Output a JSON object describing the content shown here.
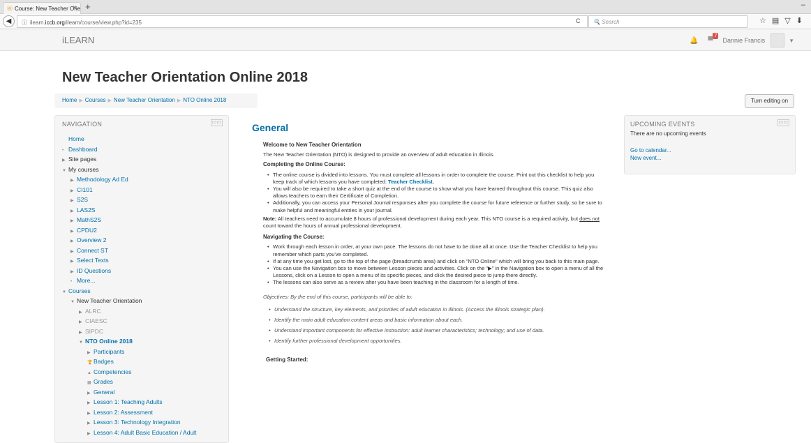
{
  "browser": {
    "tab_title": "Course: New Teacher Orient",
    "tab_close": "×",
    "new_tab": "+",
    "url_prefix": "ilearn.",
    "url_domain": "iccb.org",
    "url_path": "/ilearn/course/view.php?id=235",
    "search_placeholder": "Search",
    "minimize": "–"
  },
  "topnav": {
    "brand": "iLEARN",
    "notification_count": "7",
    "user_name": "Dannie Francis"
  },
  "page": {
    "title": "New Teacher Orientation Online 2018",
    "edit_button": "Turn editing on"
  },
  "breadcrumb": [
    "Home",
    "Courses",
    "New Teacher Orientation",
    "NTO Online 2018"
  ],
  "navigation": {
    "title": "NAVIGATION",
    "items": [
      {
        "label": "Home",
        "indent": 0,
        "marker": "",
        "link": true
      },
      {
        "label": "Dashboard",
        "indent": 0,
        "marker": "•",
        "link": true
      },
      {
        "label": "Site pages",
        "indent": 0,
        "marker": "▶",
        "link": false
      },
      {
        "label": "My courses",
        "indent": 0,
        "marker": "▼",
        "link": false
      },
      {
        "label": "Methodology Ad Ed",
        "indent": 1,
        "marker": "▶",
        "link": true
      },
      {
        "label": "CI101",
        "indent": 1,
        "marker": "▶",
        "link": true
      },
      {
        "label": "S2S",
        "indent": 1,
        "marker": "▶",
        "link": true
      },
      {
        "label": "LAS2S",
        "indent": 1,
        "marker": "▶",
        "link": true
      },
      {
        "label": "MathS2S",
        "indent": 1,
        "marker": "▶",
        "link": true
      },
      {
        "label": "CPDU2",
        "indent": 1,
        "marker": "▶",
        "link": true
      },
      {
        "label": "Overview 2",
        "indent": 1,
        "marker": "▶",
        "link": true
      },
      {
        "label": "Connect ST",
        "indent": 1,
        "marker": "▶",
        "link": true
      },
      {
        "label": "Select Texts",
        "indent": 1,
        "marker": "▶",
        "link": true
      },
      {
        "label": "ID Questions",
        "indent": 1,
        "marker": "▶",
        "link": true
      },
      {
        "label": "More...",
        "indent": 1,
        "marker": "•",
        "link": true
      },
      {
        "label": "Courses",
        "indent": 0,
        "marker": "▼",
        "link": true
      },
      {
        "label": "New Teacher Orientation",
        "indent": 1,
        "marker": "▼",
        "link": false
      },
      {
        "label": "ALRC",
        "indent": 2,
        "marker": "▶",
        "link": false,
        "gray": true
      },
      {
        "label": "CIAESC",
        "indent": 2,
        "marker": "▶",
        "link": false,
        "gray": true
      },
      {
        "label": "SIPDC",
        "indent": 2,
        "marker": "▶",
        "link": false,
        "gray": true
      },
      {
        "label": "NTO Online 2018",
        "indent": 2,
        "marker": "▼",
        "link": true,
        "bold": true
      },
      {
        "label": "Participants",
        "indent": 3,
        "marker": "▶",
        "link": true
      },
      {
        "label": "Badges",
        "indent": 3,
        "marker": "🏆",
        "link": true
      },
      {
        "label": "Competencies",
        "indent": 3,
        "marker": "▲",
        "link": true
      },
      {
        "label": "Grades",
        "indent": 3,
        "marker": "▦",
        "link": true
      },
      {
        "label": "General",
        "indent": 3,
        "marker": "▶",
        "link": true
      },
      {
        "label": "Lesson 1: Teaching Adults",
        "indent": 3,
        "marker": "▶",
        "link": true
      },
      {
        "label": "Lesson 2: Assessment",
        "indent": 3,
        "marker": "▶",
        "link": true
      },
      {
        "label": "Lesson 3: Technology Integration",
        "indent": 3,
        "marker": "▶",
        "link": true
      },
      {
        "label": "Lesson 4: Adult Basic Education / Adult",
        "indent": 3,
        "marker": "▶",
        "link": true
      }
    ]
  },
  "events": {
    "title": "UPCOMING EVENTS",
    "empty_text": "There are no upcoming events",
    "calendar_link": "Go to calendar...",
    "new_event_link": "New event..."
  },
  "main": {
    "section_title": "General",
    "welcome_heading": "Welcome to New Teacher Orientation",
    "intro": "The New Teacher Orientation (NTO) is designed to provide an overview of adult education in Illinois.",
    "completing_heading": "Completing the Online Course:",
    "completing_b1": "The online course is divided into lessons. You must complete all lessons in order to complete the course. Print out this checklist to help you keep track of which lessons you have completed: ",
    "checklist_link": "Teacher Checklist.",
    "completing_b2": "You will also be required to take a short quiz at the end of the course to show what you have learned throughout this course.  This quiz also allows teachers to earn their Certificate of Completion.",
    "completing_b3": "Additionally, you can access your Personal Journal responses after you complete the course for future reference or further study, so be sure to make helpful and meaningful entries in your journal.",
    "note_label": "Note:",
    "note_text_1": " All teachers need to accumulate 8 hours of professional development during each year. This NTO course is a required activity, but ",
    "note_underline": "does not",
    "note_text_2": " count toward the hours of annual professional development.",
    "navigating_heading": "Navigating the Course:",
    "nav_b1": "Work through each lesson in order, at your own pace. The lessons do not have to be done all at once. Use the Teacher Checklist to help you remember which parts you've completed.",
    "nav_b2": "If at any time you get lost, go to the top of the page (breadcrumb area) and click on \"NTO Online\" which will bring you back to this main page.",
    "nav_b3": "You can use the Navigation box to move between Lesson pieces and activities. Click on the \"▶\" in the Navigation box to open a menu of all the Lessons, click on a Lesson to open a menu of its specific pieces, and click the desired piece to jump there directly.",
    "nav_b4": "The lessons can also serve as a review after you have been teaching in the classroom for a length of time.",
    "objectives_intro": "Objectives: By the end of this course, participants will be able to:",
    "obj_1": "Understand the structure, key elements, and priorities of adult education in Illinois. (Access the Illinois strategic plan).",
    "obj_2": "Identify the main adult education content areas and basic information about each.",
    "obj_3": "Understand important components for effective instruction: adult learner characteristics; technology; and use of data.",
    "obj_4": "Identify further professional development opportunities.",
    "getting_started": "Getting Started:"
  }
}
